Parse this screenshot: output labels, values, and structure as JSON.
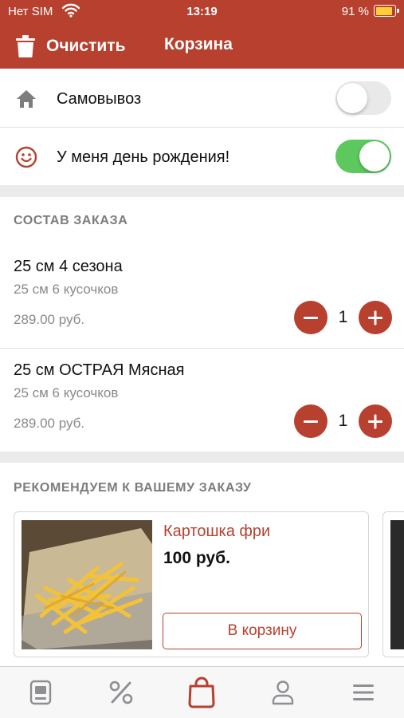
{
  "status_bar": {
    "carrier": "Нет SIM",
    "time": "13:19",
    "battery": "91 %",
    "battery_level": 0.91
  },
  "nav": {
    "clear_label": "Очистить",
    "title": "Корзина"
  },
  "settings": [
    {
      "label": "Самовывоз",
      "icon": "home-icon",
      "enabled": false
    },
    {
      "label": "У меня день рождения!",
      "icon": "smiley-icon",
      "enabled": true
    }
  ],
  "order": {
    "header": "СОСТАВ ЗАКАЗА",
    "items": [
      {
        "name": "25 см 4 сезона",
        "variant": "25 см 6 кусочков",
        "price": "289.00 руб.",
        "quantity": "1"
      },
      {
        "name": "25 см ОСТРАЯ Мясная",
        "variant": "25 см 6 кусочков",
        "price": "289.00 руб.",
        "quantity": "1"
      }
    ]
  },
  "recommend": {
    "header": "РЕКОМЕНДУЕМ К ВАШЕМУ ЗАКАЗУ",
    "items": [
      {
        "name": "Картошка фри",
        "price": "100 руб.",
        "button": "В корзину",
        "image": "french-fries-photo"
      }
    ]
  },
  "tab_bar": {
    "tabs": [
      {
        "icon": "menu-card-icon",
        "active": false
      },
      {
        "icon": "percent-icon",
        "active": false
      },
      {
        "icon": "shopping-bag-icon",
        "active": true
      },
      {
        "icon": "profile-icon",
        "active": false
      },
      {
        "icon": "hamburger-menu-icon",
        "active": false
      }
    ]
  },
  "colors": {
    "brand": "#b7402f",
    "toggle_on": "#5cc85e",
    "tab_inactive": "#8e8e93"
  }
}
